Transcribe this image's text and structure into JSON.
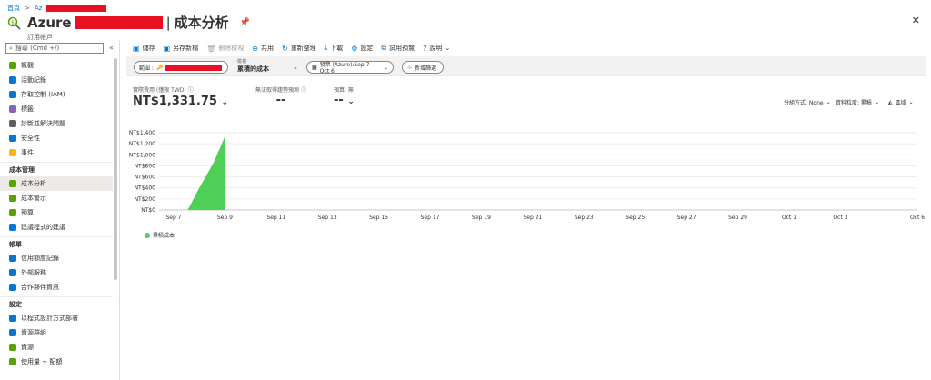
{
  "breadcrumb": {
    "home": "首頁",
    "sep": ">",
    "item": "Az"
  },
  "header": {
    "title": "Azure",
    "title_sep": "|",
    "page_title": "成本分析",
    "subtitle": "訂用帳戶"
  },
  "sidebar": {
    "search_placeholder": "搜尋 (Cmd +/)",
    "collapse_label": "«",
    "items_top": [
      {
        "label": "概觀",
        "color": "#57a300"
      },
      {
        "label": "活動記錄",
        "color": "#0078d4"
      },
      {
        "label": "存取控制 (IAM)",
        "color": "#0078d4"
      },
      {
        "label": "標籤",
        "color": "#8764b8"
      },
      {
        "label": "診斷並解決問題",
        "color": "#605e5c"
      },
      {
        "label": "安全性",
        "color": "#0078d4"
      },
      {
        "label": "事件",
        "color": "#ffb900"
      }
    ],
    "section_cost": "成本管理",
    "items_cost": [
      {
        "label": "成本分析",
        "color": "#57a300"
      },
      {
        "label": "成本警示",
        "color": "#57a300"
      },
      {
        "label": "預算",
        "color": "#57a300"
      },
      {
        "label": "建議程式的建議",
        "color": "#0078d4"
      }
    ],
    "section_billing": "帳單",
    "items_billing": [
      {
        "label": "信用額度記錄",
        "color": "#0078d4"
      },
      {
        "label": "外部服務",
        "color": "#0078d4"
      },
      {
        "label": "合作夥伴資訊",
        "color": "#0078d4"
      }
    ],
    "section_settings": "設定",
    "items_settings": [
      {
        "label": "以程式設計方式部署",
        "color": "#0078d4"
      },
      {
        "label": "資源群組",
        "color": "#0078d4"
      },
      {
        "label": "資源",
        "color": "#57a300"
      },
      {
        "label": "使用量 + 配額",
        "color": "#57a300"
      }
    ]
  },
  "toolbar": {
    "save": "儲存",
    "save_as": "另存新檔",
    "delete_view": "刪除檢視",
    "share": "共用",
    "refresh": "重新整理",
    "download": "下載",
    "settings": "設定",
    "try_preview": "試用預覽",
    "help": "說明"
  },
  "filters": {
    "scope_label": "範圍 :",
    "view_label": "檢視",
    "view_value": "累積的成本",
    "date_range": "發票 (Azure):Sep 7-Oct 6",
    "add_filter": "新增篩選"
  },
  "kpis": {
    "actual_label": "實際費用 (僅限 TWD)",
    "actual_value": "NT$1,331.75",
    "forecast_label": "無法取得趨勢預測",
    "forecast_value": "--",
    "budget_label": "預算: 無",
    "budget_value": "--"
  },
  "controls": {
    "group_by": "分組方式: None",
    "granularity": "資料粒度: 累積",
    "chart_type": "區域"
  },
  "chart_data": {
    "type": "area",
    "x": [
      "Sep 7",
      "Sep 8",
      "Sep 9",
      "Sep 10",
      "Sep 11",
      "Sep 12",
      "Sep 13",
      "Sep 14",
      "Sep 15",
      "Sep 16",
      "Sep 17",
      "Sep 18",
      "Sep 19",
      "Sep 20",
      "Sep 21",
      "Sep 22",
      "Sep 23",
      "Sep 24",
      "Sep 25",
      "Sep 26",
      "Sep 27",
      "Sep 28",
      "Sep 29",
      "Sep 30",
      "Oct 1",
      "Oct 2",
      "Oct 3",
      "Oct 4",
      "Oct 5",
      "Oct 6"
    ],
    "x_tick_labels": [
      "Sep 7",
      "Sep 9",
      "Sep 11",
      "Sep 13",
      "Sep 15",
      "Sep 17",
      "Sep 19",
      "Sep 21",
      "Sep 23",
      "Sep 25",
      "Sep 27",
      "Sep 29",
      "Oct 1",
      "Oct 3",
      "Oct 6"
    ],
    "x_tick_index": [
      0,
      2,
      4,
      6,
      8,
      10,
      12,
      14,
      16,
      18,
      20,
      22,
      24,
      26,
      29
    ],
    "series": [
      {
        "name": "累積成本",
        "color": "#4fcf55",
        "x_index": [
          0.0,
          0.55,
          1.0,
          1.55,
          2.0
        ],
        "values": [
          0,
          0,
          400,
          850,
          1331.75
        ]
      }
    ],
    "y_ticks": [
      "NT$0",
      "NT$200",
      "NT$400",
      "NT$600",
      "NT$800",
      "NT$1,000",
      "NT$1,200",
      "NT$1,400"
    ],
    "ylim": [
      0,
      1400
    ],
    "grid": true,
    "legend_position": "bottom-left"
  }
}
